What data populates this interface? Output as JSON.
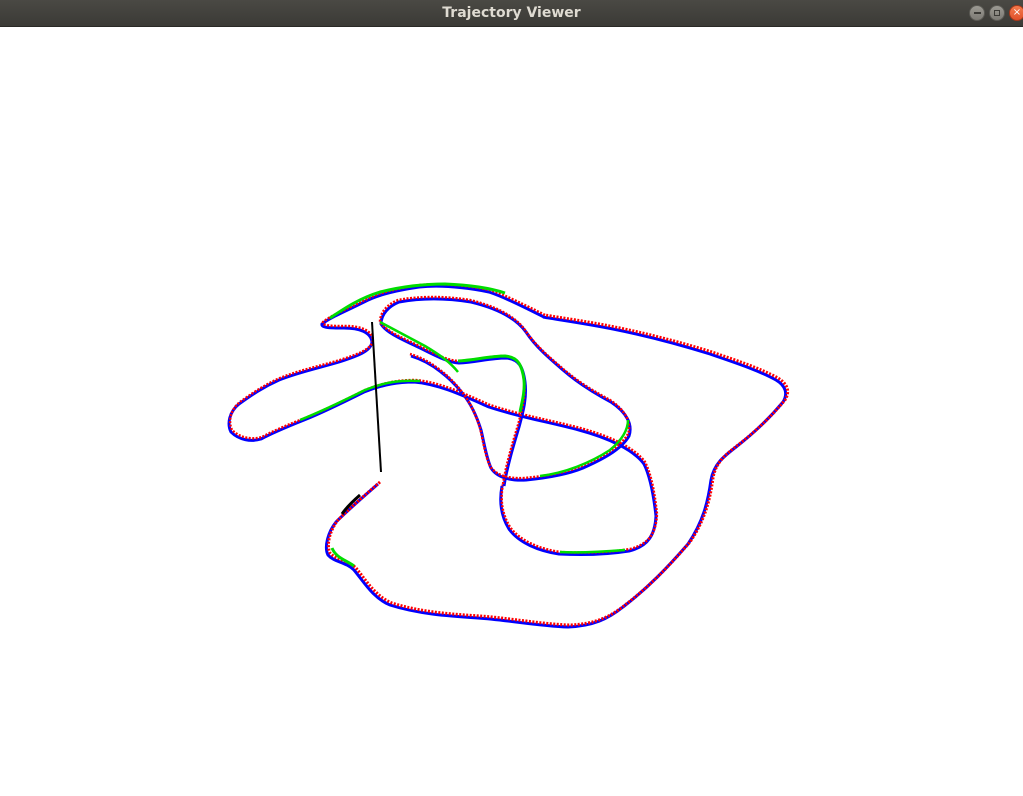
{
  "window": {
    "title": "Trajectory Viewer",
    "controls": {
      "minimize_icon": "minimize-icon",
      "maximize_icon": "maximize-icon",
      "close_glyph": "×"
    }
  },
  "colors": {
    "titlebar": "#3b3a36",
    "background": "#ffffff",
    "trajectory_red": "#ff0000",
    "trajectory_green": "#00dd00",
    "trajectory_blue": "#0000ff",
    "trajectory_black": "#000000"
  }
}
